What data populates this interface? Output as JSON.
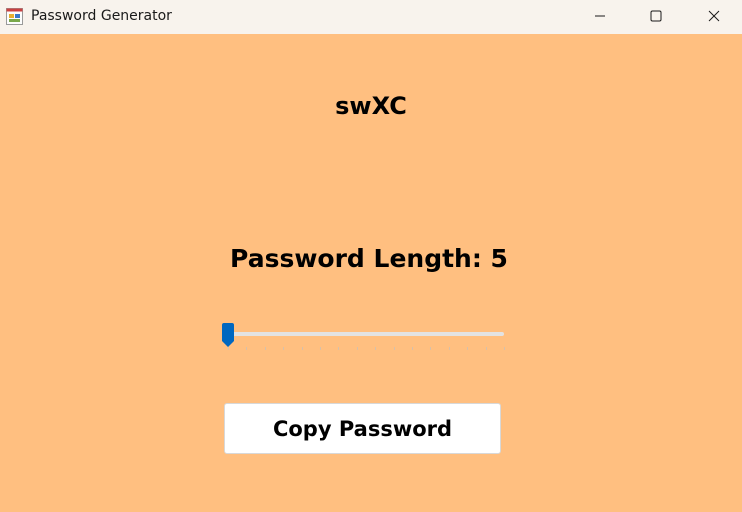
{
  "window": {
    "title": "Password Generator",
    "app_icon": "form-app-icon",
    "controls": {
      "minimize_icon": "minimize-icon",
      "maximize_icon": "maximize-icon",
      "close_icon": "close-icon"
    }
  },
  "form": {
    "background_color": "#ffbf80",
    "generated_password": "swXC",
    "length_label": "Password Length: 5",
    "slider": {
      "value": 5,
      "min": 5,
      "max": 20,
      "accent_color": "#0067c0"
    },
    "copy_button_label": "Copy Password"
  }
}
